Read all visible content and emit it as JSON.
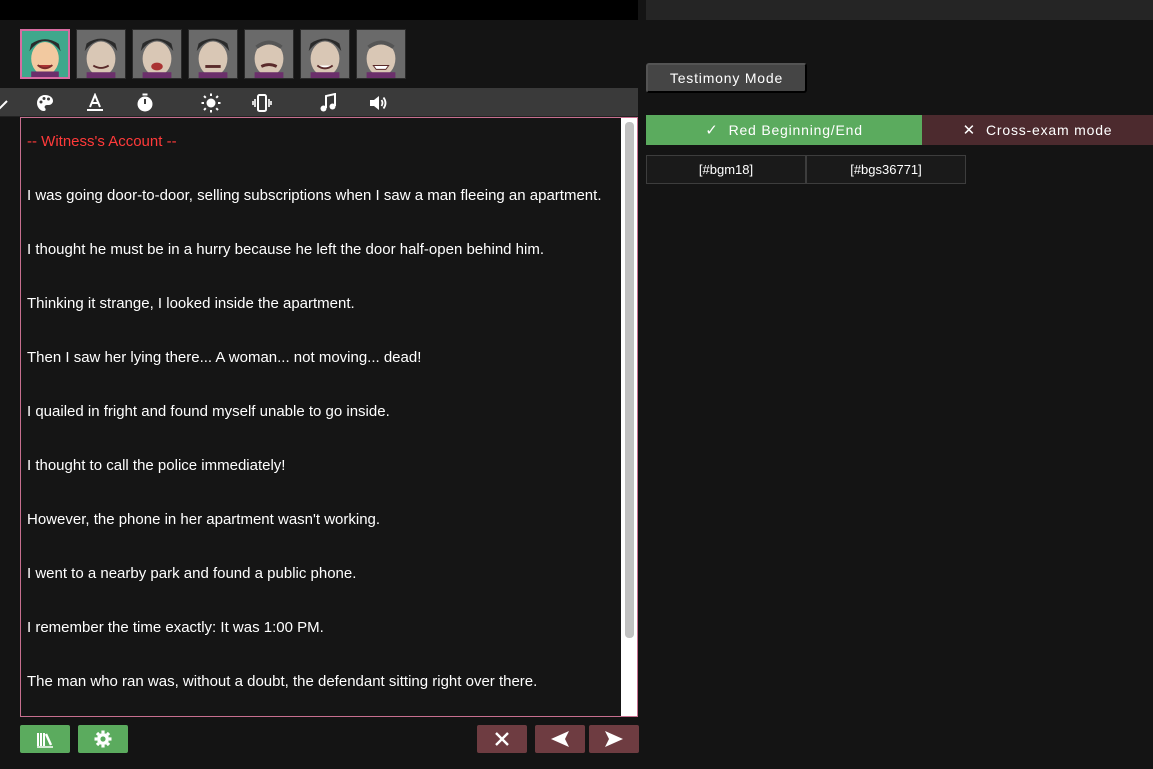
{
  "portraits": [
    {
      "name": "portrait-1",
      "selected": true
    },
    {
      "name": "portrait-2",
      "selected": false
    },
    {
      "name": "portrait-3",
      "selected": false
    },
    {
      "name": "portrait-4",
      "selected": false
    },
    {
      "name": "portrait-5",
      "selected": false
    },
    {
      "name": "portrait-6",
      "selected": false
    },
    {
      "name": "portrait-7",
      "selected": false
    }
  ],
  "toolbar": {
    "icons": [
      "palette-icon",
      "text-color-icon",
      "timer-icon",
      "brightness-icon",
      "vibrate-icon",
      "music-icon",
      "volume-icon"
    ]
  },
  "testimony": {
    "title": "-- Witness's Account --",
    "lines": [
      "I was going door-to-door, selling subscriptions when I saw a man fleeing an apartment.",
      "I thought he must be in a hurry because he left the door half-open behind him.",
      "Thinking it strange, I looked inside the apartment.",
      "Then I saw her lying there... A woman... not moving... dead!",
      "I quailed in fright and found myself unable to go inside.",
      "I thought to call the police immediately!",
      "However, the phone in her apartment wasn't working.",
      "I went to a nearby park and found a public phone.",
      "I remember the time exactly: It was 1:00 PM.",
      "The man who ran was, without a doubt, the defendant sitting right over there."
    ]
  },
  "right_panel": {
    "testimony_mode_label": "Testimony Mode",
    "red_beginning_label": "Red Beginning/End",
    "cross_exam_label": "Cross-exam mode",
    "tags": [
      "[#bgm18]",
      "[#bgs36771]"
    ]
  },
  "colors": {
    "accent_green": "#5bab5e",
    "accent_red": "#6e3c41",
    "title_red": "#ff3a3a",
    "selected_border": "#d86ca2"
  }
}
